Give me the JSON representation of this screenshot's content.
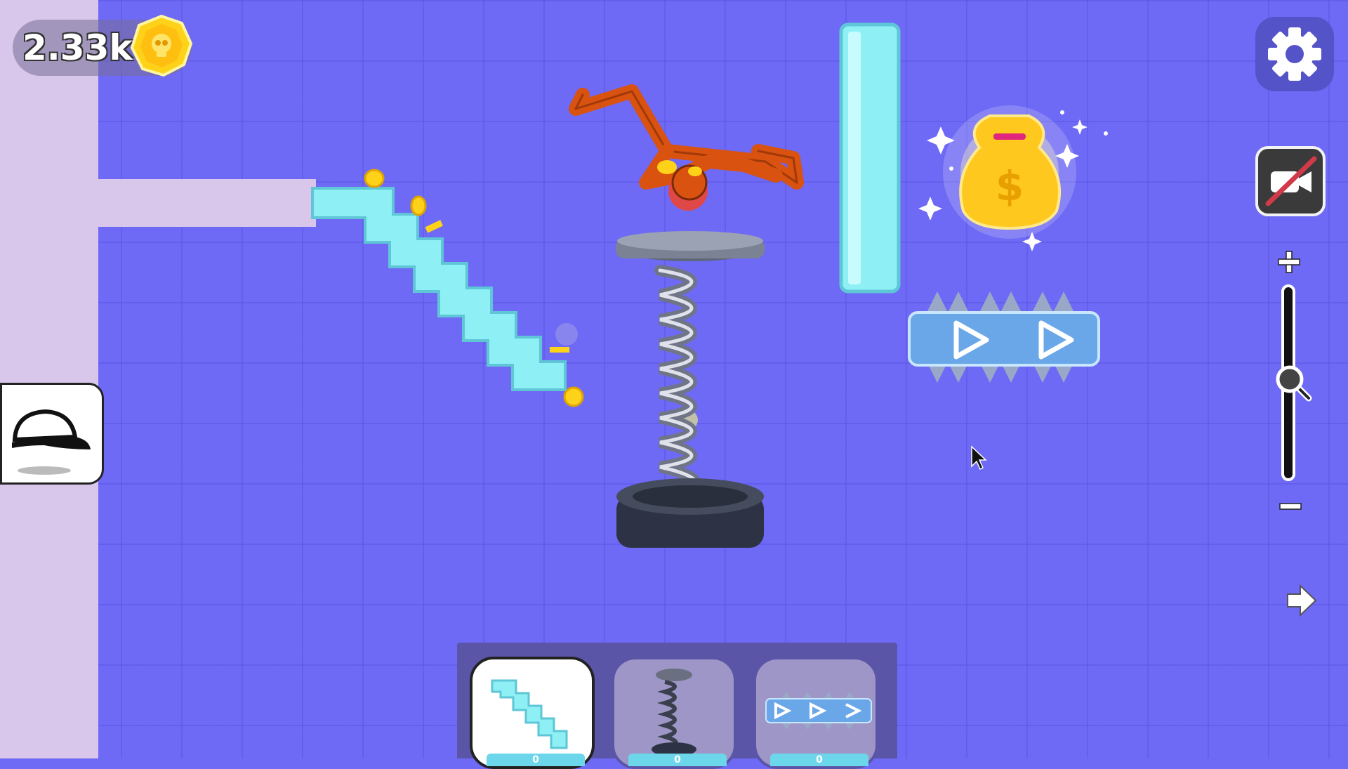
{
  "hud": {
    "coins": "2.33k",
    "coin_icon": "skull-coin-icon"
  },
  "controls": {
    "settings_icon": "gear-icon",
    "camera_icon": "camera-off-icon",
    "zoom_in_icon": "plus-icon",
    "zoom_out_icon": "minus-icon",
    "next_icon": "arrow-right-icon",
    "zoom_level": 0.45
  },
  "side": {
    "cosmetic_icon": "cap-icon"
  },
  "toolbar": {
    "items": [
      {
        "name": "stairs",
        "icon": "stairs-icon",
        "count": "0",
        "selected": true
      },
      {
        "name": "spring",
        "icon": "spring-icon",
        "count": "0",
        "selected": false
      },
      {
        "name": "conveyor",
        "icon": "conveyor-icon",
        "count": "0",
        "selected": false
      }
    ]
  },
  "colors": {
    "background": "#6e6af5",
    "wall": "#d8c7ea",
    "ice_block": "#8ef0f5",
    "coin": "#ffd21a",
    "ragdoll": "#d9520f"
  }
}
